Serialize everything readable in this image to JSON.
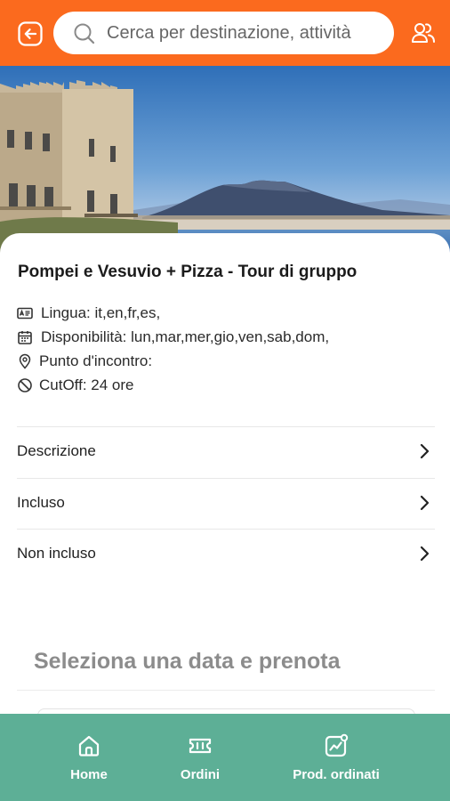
{
  "header": {
    "back_icon": "back-arrow-icon",
    "search": {
      "placeholder": "Cerca per destinazione, attività",
      "icon": "search-icon"
    },
    "account_icon": "users-icon",
    "accent": "#fb6a1e"
  },
  "tour": {
    "title": "Pompei e Vesuvio + Pizza - Tour di gruppo",
    "language": "Lingua: it,en,fr,es,",
    "availability": "Disponibilità: lun,mar,mer,gio,ven,sab,dom,",
    "meeting_point": "Punto d'incontro:",
    "cutoff": "CutOff: 24 ore"
  },
  "sections": [
    {
      "label": "Descrizione"
    },
    {
      "label": "Incluso"
    },
    {
      "label": "Non incluso"
    }
  ],
  "booking": {
    "title": "Seleziona una data e prenota"
  },
  "nav": {
    "color": "#5daf96",
    "items": [
      {
        "label": "Home",
        "icon": "home-icon"
      },
      {
        "label": "Ordini",
        "icon": "ticket-icon"
      },
      {
        "label": "Prod. ordinati",
        "icon": "chart-icon"
      }
    ]
  }
}
